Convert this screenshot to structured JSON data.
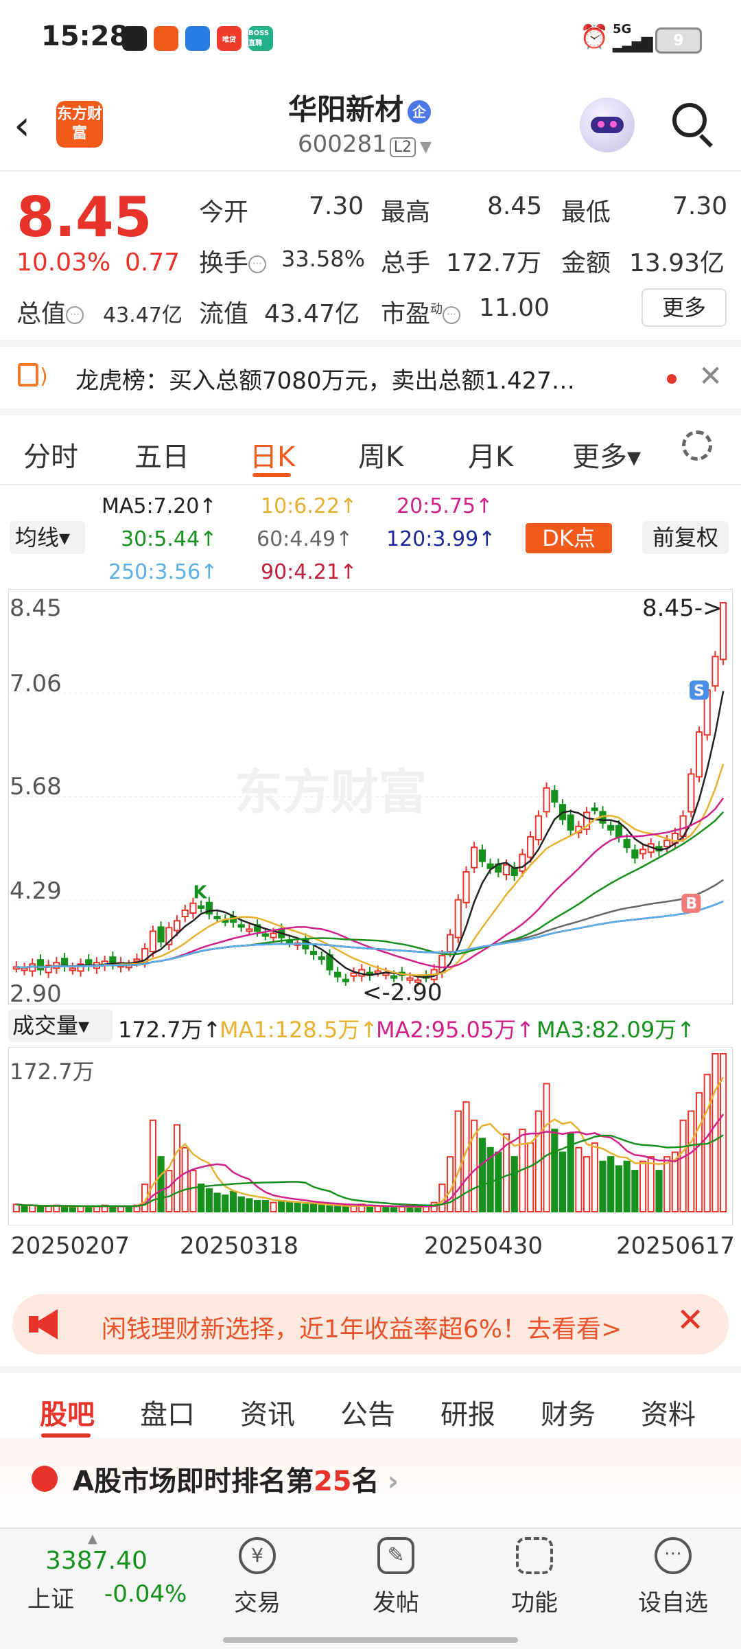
{
  "status_bar": {
    "time": "15:28",
    "network": "5G",
    "battery": "9",
    "app_icons": [
      "cube-app-icon",
      "paper-plane-app-icon",
      "cloud-app-icon",
      "pinduoduo-app-icon",
      "boss-app-icon"
    ],
    "app_icon_colors": [
      "#222222",
      "#f25a1c",
      "#2a7be4",
      "#f03c2a",
      "#22b28a"
    ],
    "app_icon_texts": [
      "",
      "",
      "",
      "唯贷",
      "BOSS直聘"
    ]
  },
  "header": {
    "back_icon": "chevron-left-icon",
    "logo_text": "东方财富",
    "name": "华阳新材",
    "name_badge": "企",
    "code": "600281",
    "level": "L2",
    "assistant_icon": "robot-avatar-icon",
    "search_icon": "search-icon"
  },
  "quote": {
    "price": "8.45",
    "change_pct": "10.03%",
    "change": "0.77",
    "open_label": "今开",
    "open": "7.30",
    "high_label": "最高",
    "high": "8.45",
    "low_label": "最低",
    "low": "7.30",
    "turnover_label": "换手",
    "turnover": "33.58%",
    "volume_label": "总手",
    "volume": "172.7万",
    "amount_label": "金额",
    "amount": "13.93亿",
    "mktcap_label": "总值",
    "mktcap": "43.47亿",
    "float_label": "流值",
    "float": "43.47亿",
    "pe_label": "市盈",
    "pe_sup": "动",
    "pe": "11.00",
    "more_label": "更多"
  },
  "news": {
    "text": "龙虎榜：买入总额7080万元，卖出总额1.427…"
  },
  "chart_tabs": {
    "items": [
      "分时",
      "五日",
      "日K",
      "周K",
      "月K",
      "更多▾"
    ],
    "active": "日K"
  },
  "ma_legend": {
    "selector": "均线▾",
    "ma5": "MA5:7.20↑",
    "ma10": "10:6.22↑",
    "ma20": "20:5.75↑",
    "ma30": "30:5.44↑",
    "ma60": "60:4.49↑",
    "ma120": "120:3.99↑",
    "ma250": "250:3.56↑",
    "ma90": "90:4.21↑",
    "dk_label": "DK点",
    "adjust_label": "前复权"
  },
  "volume_legend": {
    "selector": "成交量▾",
    "vol": "172.7万↑",
    "ma1": "MA1:128.5万↑",
    "ma2": "MA2:95.05万↑",
    "ma3": "MA3:82.09万↑",
    "max_label": "172.7万"
  },
  "chart_data": {
    "type": "candlestick",
    "title": "",
    "watermark": "东方财富",
    "y_ticks": [
      "8.45",
      "7.06",
      "5.68",
      "4.29",
      "2.90"
    ],
    "ylim": [
      2.9,
      8.45
    ],
    "x_ticks": [
      "20250207",
      "20250318",
      "20250430",
      "20250617"
    ],
    "max_marker": "8.45->",
    "min_marker": "<-2.90",
    "signal_S": "S",
    "signal_B": "B",
    "signal_K": "K",
    "ma_colors": {
      "ma5": "#222222",
      "ma10": "#e8b030",
      "ma20": "#d0208a",
      "ma30": "#17911d",
      "ma60": "#666666",
      "ma120": "#1c2a9a",
      "ma250": "#5ab0e8",
      "ma90": "#c0203a"
    },
    "closes": [
      3.24,
      3.22,
      3.28,
      3.2,
      3.26,
      3.3,
      3.25,
      3.22,
      3.28,
      3.26,
      3.3,
      3.32,
      3.28,
      3.3,
      3.26,
      3.35,
      3.5,
      3.75,
      3.6,
      3.8,
      3.9,
      4.05,
      4.15,
      4.1,
      4.0,
      3.95,
      3.9,
      3.88,
      3.82,
      3.78,
      3.75,
      3.7,
      3.72,
      3.66,
      3.6,
      3.58,
      3.5,
      3.42,
      3.35,
      3.2,
      3.1,
      3.05,
      3.15,
      3.2,
      3.12,
      3.18,
      3.15,
      3.1,
      3.12,
      3.08,
      3.05,
      3.1,
      3.2,
      3.4,
      3.7,
      4.2,
      4.6,
      4.95,
      4.75,
      4.65,
      4.6,
      4.7,
      4.55,
      4.85,
      5.1,
      5.4,
      5.8,
      5.6,
      5.35,
      5.2,
      5.25,
      5.45,
      5.5,
      5.3,
      5.2,
      5.1,
      4.95,
      4.8,
      4.92,
      5.0,
      4.9,
      5.05,
      5.15,
      5.4,
      6.0,
      6.6,
      7.2,
      7.68,
      8.45
    ],
    "volume_unit": "万",
    "volumes": [
      8,
      6,
      7,
      5,
      6,
      7,
      6,
      5,
      6,
      5,
      6,
      7,
      6,
      6,
      5,
      7,
      30,
      100,
      60,
      45,
      95,
      70,
      45,
      30,
      25,
      20,
      18,
      22,
      16,
      14,
      12,
      12,
      10,
      12,
      10,
      9,
      8,
      8,
      7,
      6,
      6,
      5,
      7,
      8,
      5,
      6,
      5,
      5,
      6,
      5,
      5,
      6,
      10,
      30,
      60,
      110,
      120,
      100,
      80,
      70,
      65,
      85,
      60,
      90,
      75,
      110,
      140,
      90,
      65,
      85,
      70,
      60,
      75,
      55,
      60,
      50,
      55,
      45,
      55,
      60,
      45,
      60,
      65,
      100,
      110,
      130,
      150,
      172.7,
      172.7
    ]
  },
  "promo": {
    "text": "闲钱理财新选择，近1年收益率超6%！去看看>"
  },
  "section_tabs": {
    "items": [
      "股吧",
      "盘口",
      "资讯",
      "公告",
      "研报",
      "财务",
      "资料"
    ],
    "active": "股吧"
  },
  "rank": {
    "prefix": "A股市场即时排名第",
    "number": "25",
    "suffix": "名",
    "chevron": "›"
  },
  "bottom_nav": {
    "index_value": "3387.40",
    "index_name": "上证",
    "index_pct": "-0.04%",
    "items": [
      "交易",
      "发帖",
      "功能",
      "设自选"
    ]
  }
}
